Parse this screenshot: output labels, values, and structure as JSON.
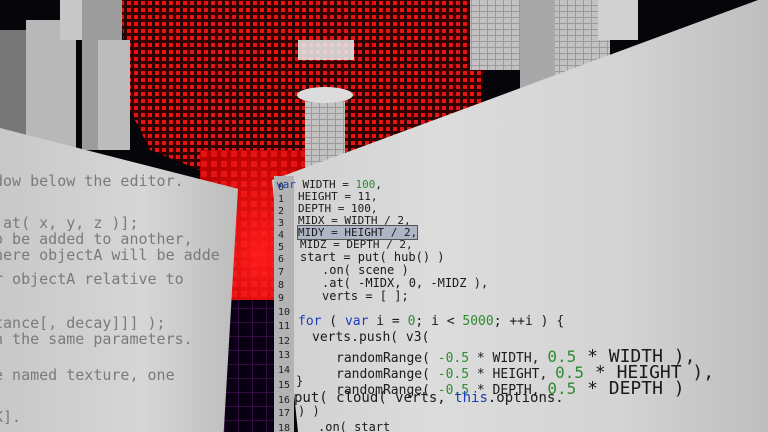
{
  "doc_panel": {
    "lines": [
      "dow below the editor.",
      ".at( x, y, z )];",
      "o be added to another,",
      "here objectA will be adde",
      "r objectA relative to",
      "tance[, decay]]] );",
      "h the same parameters.",
      "e named texture, one",
      "K]."
    ]
  },
  "editor": {
    "line_numbers": [
      "0",
      "1",
      "2",
      "3",
      "4",
      "5",
      "6",
      "7",
      "8",
      "9",
      "10",
      "11",
      "12",
      "13",
      "14",
      "15",
      "16",
      "17",
      "18"
    ],
    "code": {
      "l0_kw": "var",
      "l0_rest": " WIDTH = ",
      "l0_num": "100",
      "l0_end": ",",
      "l1": "HEIGHT = 11,",
      "l2": "DEPTH = 100,",
      "l3": "MIDX = WIDTH / 2,",
      "l4": "MIDY = HEIGHT / 2,",
      "l5": "MIDZ = DEPTH / 2,",
      "l6": "start = put( hub() )",
      "l7": ".on( scene )",
      "l8": ".at( -MIDX, 0, -MIDZ ),",
      "l9": "verts = [ ];",
      "l11_kw1": "for",
      "l11_a": " ( ",
      "l11_kw2": "var",
      "l11_b": " i = ",
      "l11_n1": "0",
      "l11_c": "; i < ",
      "l11_n2": "5000",
      "l11_d": "; ++i ) {",
      "l12": "verts.push( v3(",
      "l13_a": "randomRange( ",
      "l13_n1": "-0.5",
      "l13_b": " * WIDTH, ",
      "l13_n2": "0.5",
      "l13_c": " * WIDTH ),",
      "l14_a": "randomRange( ",
      "l14_n1": "-0.5",
      "l14_b": " * HEIGHT, ",
      "l14_n2": "0.5",
      "l14_c": " * HEIGHT ),",
      "l15_a": "randomRange( ",
      "l15_n1": "-0.5",
      "l15_b": " * DEPTH, ",
      "l15_n2": "0.5",
      "l15_c": " * DEPTH )",
      "l16": "}",
      "l17_a": "put( cloud( verts, ",
      "l17_kw": "this",
      "l17_b": ".options.",
      "l17b": ") )",
      "l18": ".on( start"
    }
  },
  "colors": {
    "sky": "#05050a",
    "red_dots": "#e31414",
    "floor_grid": "#6a1a6a",
    "keyword": "#1c3fb8",
    "number": "#2e8b2e"
  }
}
